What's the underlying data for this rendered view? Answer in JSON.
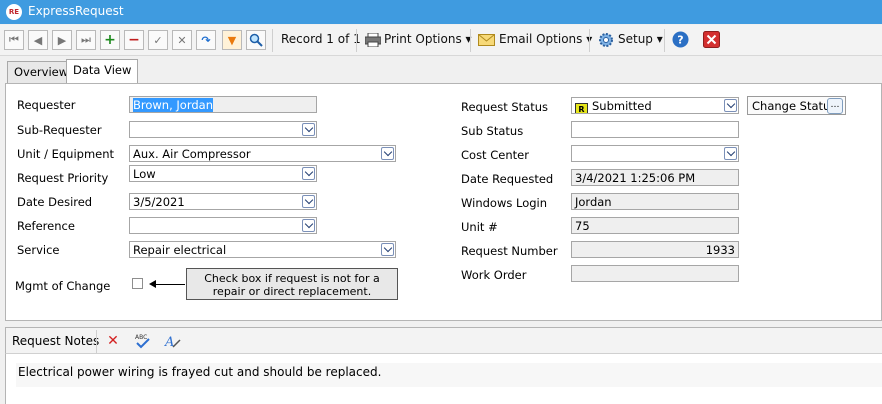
{
  "window": {
    "title": "ExpressRequest",
    "app_icon": "RE"
  },
  "toolbar": {
    "record_label": "Record 1 of 1",
    "print_options": "Print Options",
    "email_options": "Email Options",
    "setup": "Setup",
    "icons": [
      "first-record-icon",
      "previous-record-icon",
      "next-record-icon",
      "last-record-icon",
      "add-icon",
      "delete-icon",
      "save-check-icon",
      "cancel-x-icon",
      "refresh-icon",
      "filter-icon",
      "search-zoom-icon",
      "printer-icon",
      "envelope-icon",
      "gear-icon",
      "help-icon",
      "close-icon"
    ]
  },
  "tabs": [
    {
      "label": "Overview"
    },
    {
      "label": "Data View",
      "active": true
    }
  ],
  "form": {
    "requester": {
      "label": "Requester",
      "value": "Brown, Jordan"
    },
    "sub_requester": {
      "label": "Sub-Requester",
      "value": ""
    },
    "unit_equipment": {
      "label": "Unit / Equipment",
      "value": "Aux. Air Compressor"
    },
    "request_priority": {
      "label": "Request Priority",
      "value": "Low"
    },
    "date_desired": {
      "label": "Date Desired",
      "value": "3/5/2021"
    },
    "reference": {
      "label": "Reference",
      "value": ""
    },
    "service": {
      "label": "Service",
      "value": "Repair electrical"
    },
    "mgmt_of_change": {
      "label": "Mgmt of Change",
      "checked": false
    },
    "callout": "Check box if request is not for a repair or direct replacement.",
    "request_status": {
      "label": "Request Status",
      "value": "Submitted"
    },
    "change_status_button": "Change Status",
    "sub_status": {
      "label": "Sub Status",
      "value": ""
    },
    "cost_center": {
      "label": "Cost Center",
      "value": ""
    },
    "date_requested": {
      "label": "Date Requested",
      "value": "3/4/2021 1:25:06 PM"
    },
    "windows_login": {
      "label": "Windows Login",
      "value": "Jordan"
    },
    "unit_no": {
      "label": "Unit #",
      "value": "75"
    },
    "request_number": {
      "label": "Request Number",
      "value": "1933"
    },
    "work_order": {
      "label": "Work Order",
      "value": ""
    }
  },
  "notes": {
    "title": "Request Notes",
    "text": "Electrical power wiring is frayed cut and should be replaced."
  },
  "colors": {
    "titlebar": "#3f9be0",
    "selection": "#3399ff",
    "status_icon": "#e6e61a"
  }
}
